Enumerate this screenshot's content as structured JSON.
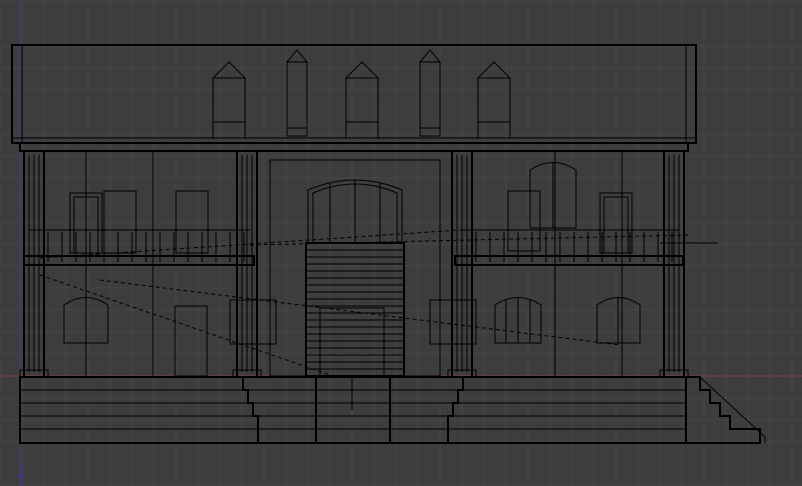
{
  "viewport": {
    "background": "#3d3d3d",
    "grid_color": "#474747",
    "axis_x_color": "#8a3a3a",
    "axis_y_color": "#3a3a8a",
    "wire_color": "#000000"
  },
  "model": {
    "description_visible": false,
    "object": "house-wireframe-front"
  }
}
